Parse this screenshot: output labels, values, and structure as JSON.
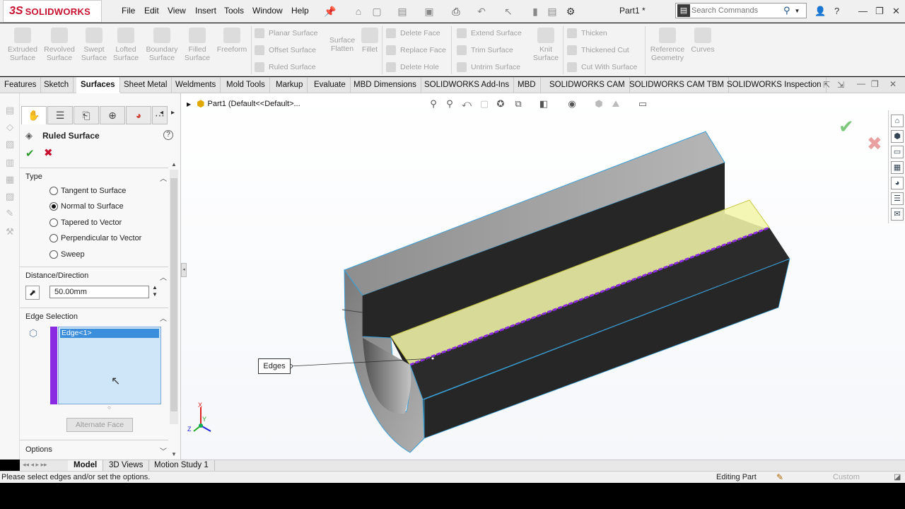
{
  "app": {
    "logo_mark": "3S",
    "logo_text": "SOLIDWORKS",
    "doc_title": "Part1 *"
  },
  "menu": [
    "File",
    "Edit",
    "View",
    "Insert",
    "Tools",
    "Window",
    "Help"
  ],
  "search": {
    "placeholder": "Search Commands"
  },
  "ribbon": {
    "big_buttons": [
      {
        "label": "Extruded Surface",
        "icon": "extrude-icon"
      },
      {
        "label": "Revolved Surface",
        "icon": "revolve-icon"
      },
      {
        "label": "Swept Surface",
        "icon": "sweep-icon"
      },
      {
        "label": "Lofted Surface",
        "icon": "loft-icon"
      },
      {
        "label": "Boundary Surface",
        "icon": "boundary-icon"
      },
      {
        "label": "Filled Surface",
        "icon": "fill-icon"
      },
      {
        "label": "Freeform",
        "icon": "freeform-icon"
      }
    ],
    "col1": [
      "Planar Surface",
      "Offset Surface",
      "Ruled Surface"
    ],
    "flatten": "Surface Flatten",
    "fillet": "Fillet",
    "col2": [
      "Delete Face",
      "Replace Face",
      "Delete Hole"
    ],
    "col3": [
      "Extend Surface",
      "Trim Surface",
      "Untrim Surface"
    ],
    "knit": "Knit Surface",
    "col4": [
      "Thicken",
      "Thickened Cut",
      "Cut With Surface"
    ],
    "ref_geo": "Reference Geometry",
    "curves": "Curves"
  },
  "tabs": [
    "Features",
    "Sketch",
    "Surfaces",
    "Sheet Metal",
    "Weldments",
    "Mold Tools",
    "Markup",
    "Evaluate",
    "MBD Dimensions",
    "SOLIDWORKS Add-Ins",
    "MBD",
    "SOLIDWORKS CAM",
    "SOLIDWORKS CAM TBM",
    "SOLIDWORKS Inspection"
  ],
  "active_tab": "Surfaces",
  "property_manager": {
    "title": "Ruled Surface",
    "help": "?",
    "ok": "✔",
    "cancel": "✖",
    "type_label": "Type",
    "type_options": [
      "Tangent to Surface",
      "Normal to Surface",
      "Tapered to Vector",
      "Perpendicular to Vector",
      "Sweep"
    ],
    "selected_type": "Normal to Surface",
    "distance_label": "Distance/Direction",
    "distance_value": "50.00mm",
    "edge_label": "Edge Selection",
    "edge_items": [
      "Edge<1>"
    ],
    "alternate_face": "Alternate Face",
    "options_label": "Options"
  },
  "graphics": {
    "tree_text": "Part1  (Default<<Default>...",
    "callout": "Edges",
    "triad": {
      "x": "X",
      "y": "Y",
      "z": "Z"
    }
  },
  "bottom_tabs": [
    "Model",
    "3D Views",
    "Motion Study 1"
  ],
  "active_bottom": "Model",
  "status": {
    "message": "Please select edges and/or set the options.",
    "mode": "Editing Part",
    "units": "Custom"
  },
  "colors": {
    "brand": "#c8102e",
    "selection": "#8a2be2",
    "face_highlight": "#f2f5a8",
    "part_body": "#2a2a2a"
  }
}
